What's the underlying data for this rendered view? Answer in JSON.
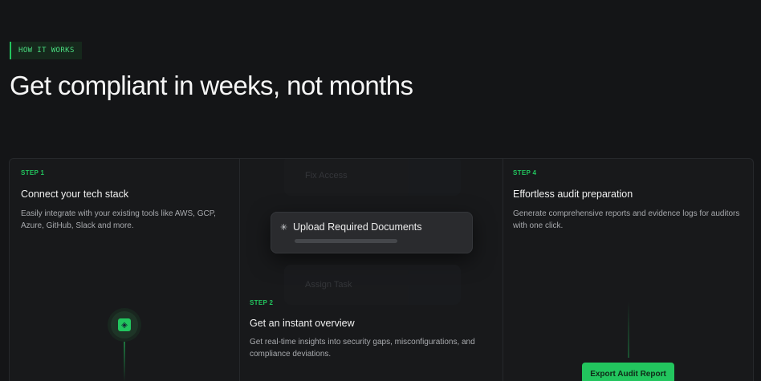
{
  "section_badge": "HOW IT WORKS",
  "headline": "Get compliant in weeks, not months",
  "steps": [
    {
      "label": "STEP 1",
      "title": "Connect your tech stack",
      "description": "Easily integrate with your existing tools like AWS, GCP, Azure, GitHub, Slack and more."
    },
    {
      "label": "STEP 2",
      "title": "Get an instant overview",
      "description": "Get real-time insights into security gaps, misconfigurations, and compliance deviations."
    },
    {
      "label": "STEP 4",
      "title": "Effortless audit preparation",
      "description": "Generate comprehensive reports and evidence logs for auditors with one click."
    }
  ],
  "task_cards": {
    "above": "Fix Access",
    "active": "Upload Required Documents",
    "below": "Assign Task"
  },
  "export_button": "Export Audit Report",
  "colors": {
    "background": "#141517",
    "accent": "#22c55e",
    "card": "#2a2b2e"
  },
  "icons": {
    "active_task": "spinner-icon",
    "integration_node": "integration-icon"
  }
}
